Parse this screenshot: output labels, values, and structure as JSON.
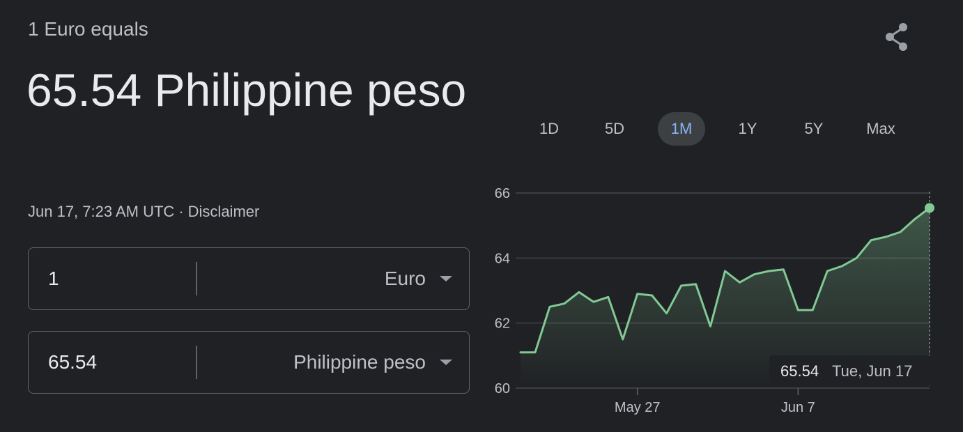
{
  "summary": {
    "subtitle": "1 Euro equals",
    "headline": "65.54 Philippine peso",
    "timestamp": "Jun 17, 7:23 AM UTC",
    "separator": "·",
    "disclaimer": "Disclaimer"
  },
  "converter": {
    "from": {
      "amount": "1",
      "currency": "Euro"
    },
    "to": {
      "amount": "65.54",
      "currency": "Philippine peso"
    }
  },
  "share": {
    "icon": "share-icon"
  },
  "ranges": [
    {
      "label": "1D",
      "active": false
    },
    {
      "label": "5D",
      "active": false
    },
    {
      "label": "1M",
      "active": true
    },
    {
      "label": "1Y",
      "active": false
    },
    {
      "label": "5Y",
      "active": false
    },
    {
      "label": "Max",
      "active": false
    }
  ],
  "colors": {
    "background": "#202124",
    "line": "#81c995",
    "active_range_text": "#8ab4f8",
    "active_range_bg": "#3c4043",
    "grid": "#5f6368"
  },
  "chart_data": {
    "type": "line",
    "x": [
      1,
      2,
      3,
      4,
      5,
      6,
      7,
      8,
      9,
      10,
      11,
      12,
      13,
      14,
      15,
      16,
      17,
      18,
      19,
      20,
      21,
      22,
      23,
      24,
      25,
      26,
      27,
      28,
      29,
      30
    ],
    "values": [
      61.1,
      61.1,
      62.5,
      62.6,
      62.95,
      62.65,
      62.8,
      61.5,
      62.9,
      62.85,
      62.3,
      63.15,
      63.2,
      61.9,
      63.6,
      63.25,
      63.5,
      63.6,
      63.65,
      62.4,
      62.4,
      63.6,
      63.75,
      64.0,
      64.55,
      64.65,
      64.8,
      65.2,
      65.54
    ],
    "ylim": [
      60,
      66
    ],
    "yticks": [
      "60",
      "62",
      "64",
      "66"
    ],
    "xticks": [
      {
        "label": "May 27",
        "index": 8
      },
      {
        "label": "Jun 7",
        "index": 19
      }
    ],
    "grid": true,
    "tooltip": {
      "value": "65.54",
      "date": "Tue, Jun 17"
    }
  }
}
